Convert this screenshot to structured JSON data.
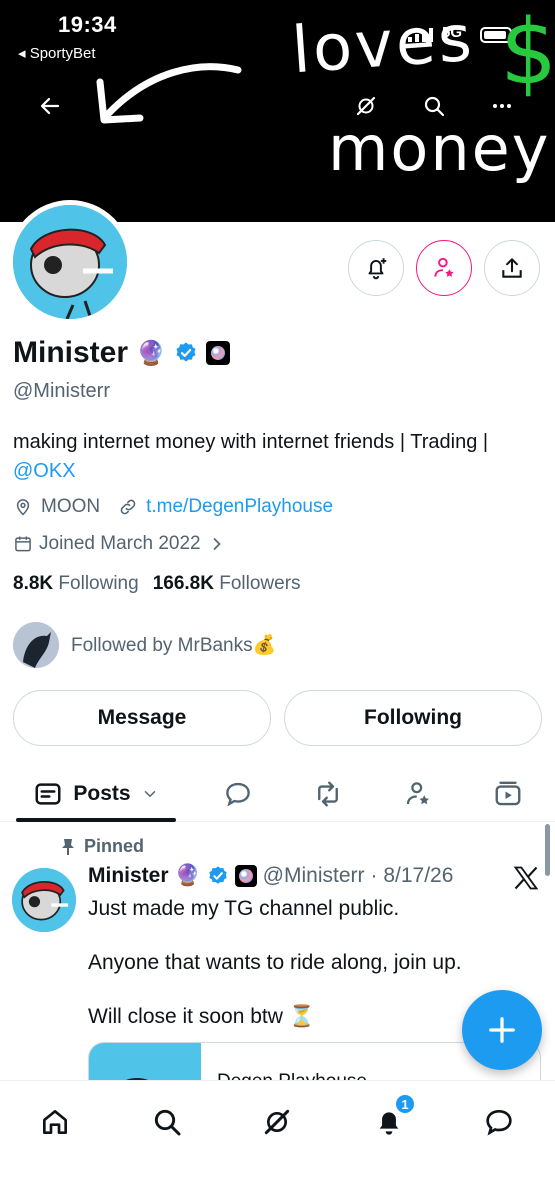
{
  "status_bar": {
    "time": "19:34",
    "back_app": "◂ SportyBet",
    "network": "5G"
  },
  "banner": {
    "handwriting_word1": "loves",
    "handwriting_word2": "money",
    "handwriting_symbol": "$"
  },
  "profile": {
    "display_name": "Minister",
    "name_emoji": "🔮",
    "handle": "@Ministerr",
    "bio_text": "making internet money with internet friends | Trading |",
    "bio_link": "@OKX",
    "location": "MOON",
    "website": "t.me/DegenPlayhouse",
    "joined": "Joined March 2022",
    "following_count": "8.8K",
    "following_label": "Following",
    "followers_count": "166.8K",
    "followers_label": "Followers",
    "followed_by": "Followed by MrBanks💰"
  },
  "actions": {
    "message_label": "Message",
    "following_label": "Following"
  },
  "tabs": {
    "posts_label": "Posts"
  },
  "tweet": {
    "pinned_label": "Pinned",
    "author_name": "Minister",
    "author_emoji": "🔮",
    "author_handle": "@Ministerr",
    "date": "· 8/17/26",
    "line1": "Just made my TG channel public.",
    "line2": "Anyone that wants to ride along, join up.",
    "line3": "Will close it soon btw ⏳",
    "card_title": "Degen Playhouse"
  },
  "bottom_nav": {
    "notifications_count": "1"
  },
  "colors": {
    "accent": "#1d9bf0",
    "pink": "#f91880",
    "text": "#0f1419",
    "muted": "#536471"
  }
}
